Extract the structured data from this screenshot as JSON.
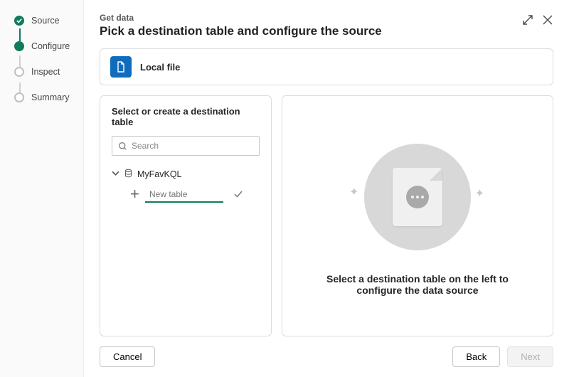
{
  "steps": {
    "s0": "Source",
    "s1": "Configure",
    "s2": "Inspect",
    "s3": "Summary"
  },
  "header": {
    "eyebrow": "Get data",
    "title": "Pick a destination table and configure the source"
  },
  "source": {
    "label": "Local file"
  },
  "leftPanel": {
    "title": "Select or create a destination table",
    "searchPlaceholder": "Search",
    "dbName": "MyFavKQL",
    "newTablePlaceholder": "New table"
  },
  "rightPanel": {
    "message": "Select a destination table on the left to configure the data source"
  },
  "buttons": {
    "cancel": "Cancel",
    "back": "Back",
    "next": "Next"
  }
}
